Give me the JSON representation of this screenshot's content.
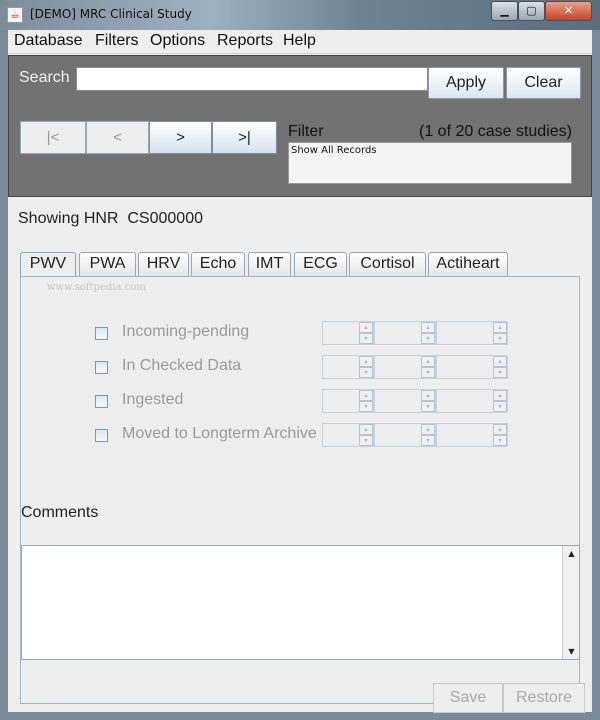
{
  "window": {
    "title": "[DEMO] MRC Clinical Study",
    "icon": "java-cup-icon"
  },
  "menu": [
    "Database",
    "Filters",
    "Options",
    "Reports",
    "Help"
  ],
  "search": {
    "label": "Search",
    "value": "",
    "apply_label": "Apply",
    "clear_label": "Clear"
  },
  "navigation": {
    "first": "|<",
    "prev": "<",
    "next": ">",
    "last": ">|"
  },
  "filter": {
    "label": "Filter",
    "count": "(1 of 20 case studies)",
    "selected_option": "Show All Records"
  },
  "record": {
    "showing_label": "Showing HNR",
    "id": "CS000000"
  },
  "tabs": [
    "PWV",
    "PWA",
    "HRV",
    "Echo",
    "IMT",
    "ECG",
    "Cortisol",
    "Actiheart"
  ],
  "active_tab": "PWV",
  "watermark": "www.softpedia.com",
  "statuses": [
    {
      "label": "Incoming-pending",
      "checked": false
    },
    {
      "label": "In Checked Data",
      "checked": false
    },
    {
      "label": "Ingested",
      "checked": false
    },
    {
      "label": "Moved to Longterm Archive",
      "checked": false
    }
  ],
  "comments": {
    "label": "Comments",
    "value": ""
  },
  "footer": {
    "save_label": "Save",
    "restore_label": "Restore"
  }
}
